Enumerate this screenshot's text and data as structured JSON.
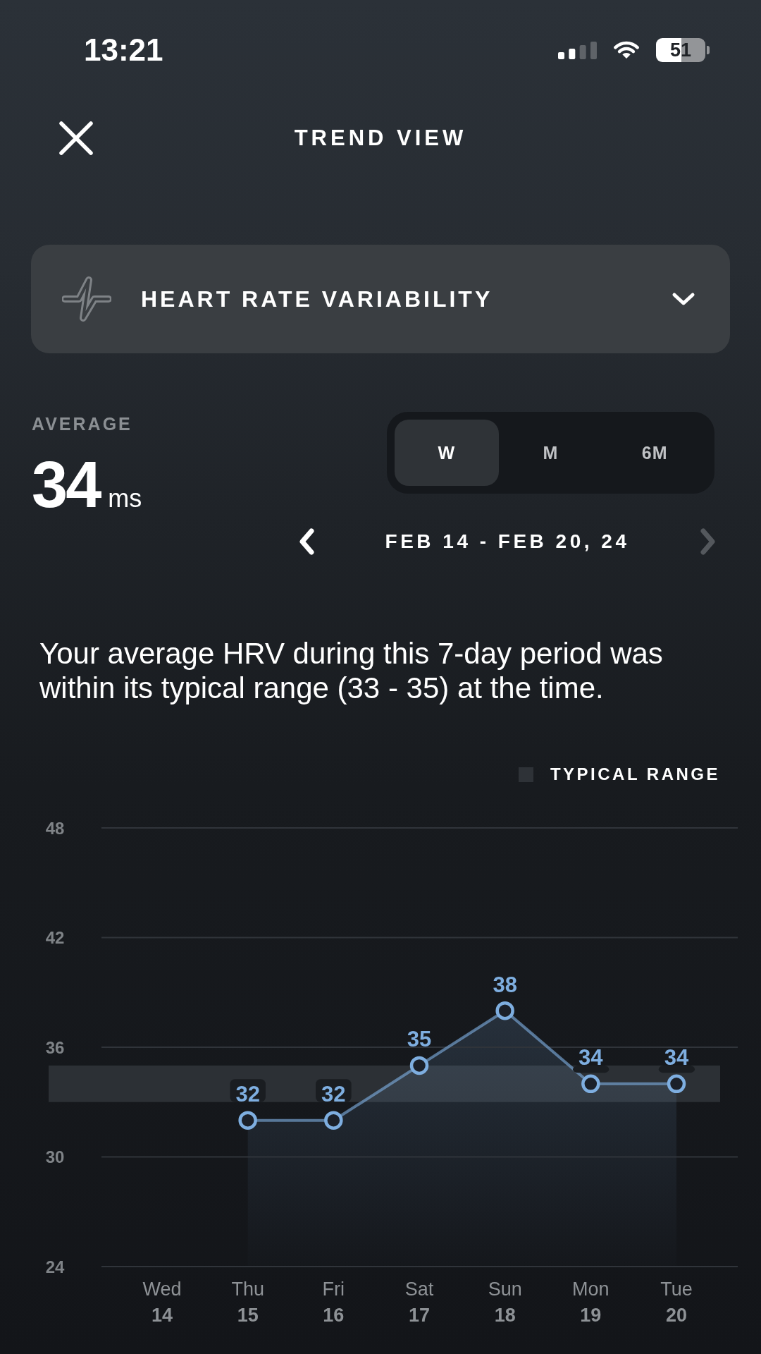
{
  "status_bar": {
    "time": "13:21",
    "battery": "51"
  },
  "header": {
    "title": "TREND VIEW"
  },
  "metric_dropdown": {
    "label": "HEART RATE VARIABILITY",
    "expanded": false
  },
  "average": {
    "label": "AVERAGE",
    "value": "34",
    "unit": "ms"
  },
  "period_tabs": [
    {
      "label": "W",
      "selected": true
    },
    {
      "label": "M",
      "selected": false
    },
    {
      "label": "6M",
      "selected": false
    }
  ],
  "date_nav": {
    "previous": {
      "disabled": false
    },
    "label": "FEB 14 - FEB 20, 24",
    "next": {
      "disabled": true
    }
  },
  "summary": "Your average HRV during this 7-day period was within its typical range (33 - 35) at the time.",
  "chart": {
    "legend": [
      {
        "label": "TYPICAL RANGE"
      }
    ],
    "chart_data": {
      "type": "line",
      "categories": [
        "Wed\n14",
        "Thu\n15",
        "Fri\n16",
        "Sat\n17",
        "Sun\n18",
        "Mon\n19",
        "Tue\n20"
      ],
      "series": [
        {
          "color": "#7eaee0",
          "marker": "o",
          "values": [
            null,
            32,
            32,
            35,
            38,
            34,
            34
          ]
        }
      ],
      "ylim": [
        24,
        48
      ],
      "yticks": [
        24,
        30,
        36,
        42,
        48
      ],
      "grid": true,
      "data_labels": true,
      "bands": [
        {
          "axis": "y",
          "from": 33,
          "to": 35
        }
      ]
    }
  }
}
